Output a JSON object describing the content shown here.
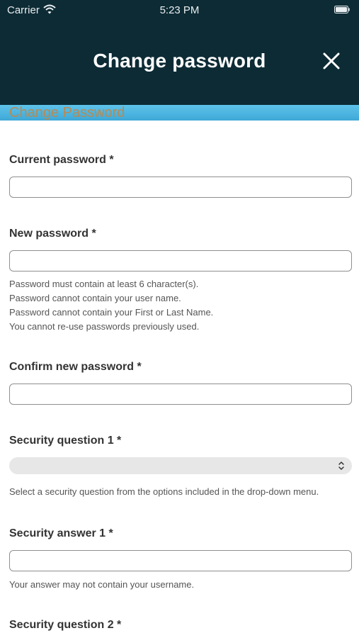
{
  "status_bar": {
    "carrier": "Carrier",
    "time": "5:23 PM"
  },
  "header": {
    "title": "Change password",
    "close_icon": "close-icon"
  },
  "banner": {
    "text": "Change Password"
  },
  "form": {
    "current_password": {
      "label": "Current password *",
      "value": ""
    },
    "new_password": {
      "label": "New password *",
      "value": "",
      "help": [
        "Password must contain at least 6 character(s).",
        "Password cannot contain your user name.",
        "Password cannot contain your First or Last Name.",
        "You cannot re-use passwords previously used."
      ]
    },
    "confirm_password": {
      "label": "Confirm new password *",
      "value": ""
    },
    "security_question_1": {
      "label": "Security question 1 *",
      "selected": "",
      "help": "Select a security question from the options included in the drop-down menu."
    },
    "security_answer_1": {
      "label": "Security answer 1 *",
      "value": "",
      "help": "Your answer may not contain your username."
    },
    "security_question_2": {
      "label": "Security question 2 *"
    }
  },
  "colors": {
    "header_bg": "#0d2b35",
    "banner_bg": "#4db6e2",
    "banner_text": "#b78a55"
  }
}
